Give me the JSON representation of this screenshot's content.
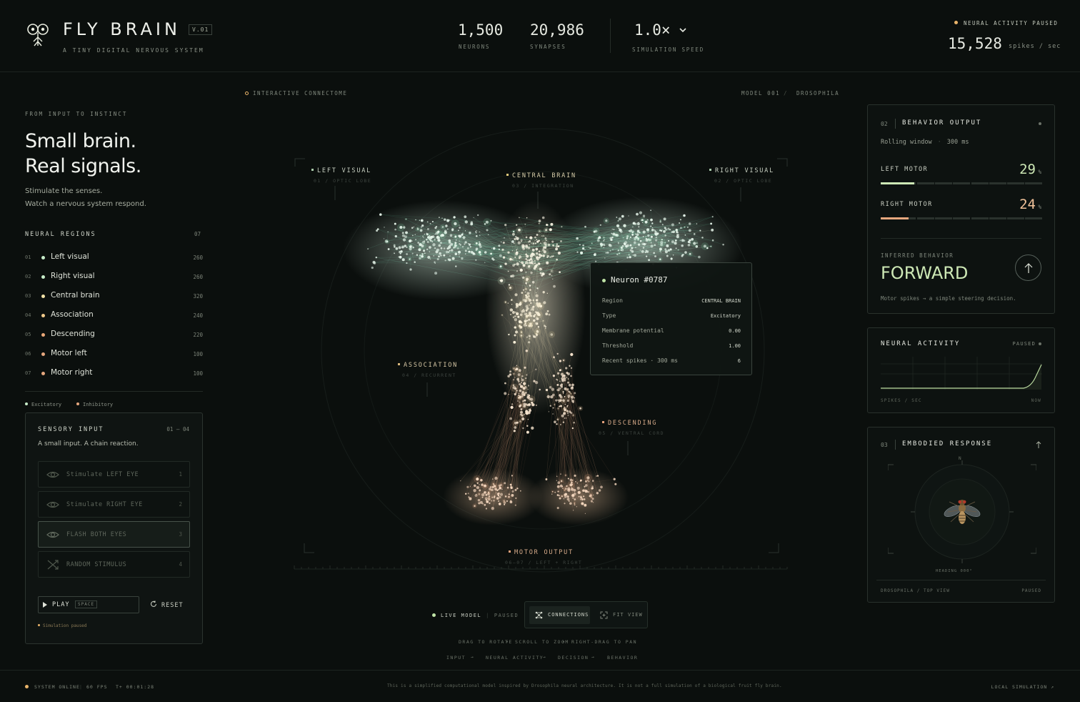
{
  "header": {
    "brand": "FLY BRAIN",
    "version": "V.01",
    "tagline": "A TINY DIGITAL NERVOUS SYSTEM",
    "neurons_value": "1,500",
    "neurons_label": "NEURONS",
    "synapses_value": "20,986",
    "synapses_label": "SYNAPSES",
    "speed_value": "1.0×",
    "speed_label": "SIMULATION SPEED",
    "status": "NEURAL ACTIVITY PAUSED",
    "spikes_value": "15,528",
    "spikes_unit": "spikes / sec"
  },
  "left": {
    "eyebrow": "FROM INPUT TO INSTINCT",
    "headline_line1": "Small brain.",
    "headline_line2": "Real signals.",
    "sub_line1": "Stimulate the senses.",
    "sub_line2": "Watch a nervous system respond.",
    "regions_title": "NEURAL REGIONS",
    "regions_count": "07",
    "regions": [
      {
        "idx": "01",
        "name": "Left visual",
        "count": "260",
        "color": "#c7ecc9"
      },
      {
        "idx": "02",
        "name": "Right visual",
        "count": "260",
        "color": "#c7ecc9"
      },
      {
        "idx": "03",
        "name": "Central brain",
        "count": "320",
        "color": "#f2e2a8"
      },
      {
        "idx": "04",
        "name": "Association",
        "count": "240",
        "color": "#f0c98a"
      },
      {
        "idx": "05",
        "name": "Descending",
        "count": "220",
        "color": "#eaa878"
      },
      {
        "idx": "06",
        "name": "Motor left",
        "count": "100",
        "color": "#e6a77e"
      },
      {
        "idx": "07",
        "name": "Motor right",
        "count": "100",
        "color": "#e6a77e"
      }
    ],
    "legend_excitatory": "Excitatory",
    "legend_inhibitory": "Inhibitory",
    "sensory": {
      "title": "SENSORY INPUT",
      "range": "01 — 04",
      "desc": "A small input. A chain reaction.",
      "buttons": [
        {
          "label": "Stimulate LEFT EYE",
          "key": "1"
        },
        {
          "label": "Stimulate RIGHT EYE",
          "key": "2"
        },
        {
          "label": "FLASH BOTH EYES",
          "key": "3"
        },
        {
          "label": "RANDOM STIMULUS",
          "key": "4"
        }
      ],
      "play_label": "PLAY",
      "play_key": "SPACE",
      "reset_label": "RESET",
      "status": "Simulation paused"
    }
  },
  "center": {
    "connectome_label": "INTERACTIVE CONNECTOME",
    "model_label": "MODEL 001",
    "species_label": "DROSOPHILA",
    "regions": {
      "left_visual": "LEFT VISUAL",
      "left_visual_sub": "01 / OPTIC LOBE",
      "central_brain": "CENTRAL BRAIN",
      "central_brain_sub": "03 / INTEGRATION",
      "right_visual": "RIGHT VISUAL",
      "right_visual_sub": "02 / OPTIC LOBE",
      "association": "ASSOCIATION",
      "association_sub": "04 / RECURRENT",
      "descending": "DESCENDING",
      "descending_sub": "05 / VENTRAL CORD",
      "motor_output": "MOTOR OUTPUT",
      "motor_output_sub": "06—07 / LEFT + RIGHT"
    },
    "tooltip": {
      "title": "Neuron #0787",
      "rows": [
        {
          "k": "Region",
          "v": "CENTRAL BRAIN"
        },
        {
          "k": "Type",
          "v": "Excitatory"
        },
        {
          "k": "Membrane potential",
          "v": "0.00"
        },
        {
          "k": "Threshold",
          "v": "1.00"
        },
        {
          "k": "Recent spikes · 300 ms",
          "v": "6"
        }
      ]
    },
    "live_model": "LIVE MODEL",
    "live_state": "PAUSED",
    "connections": "CONNECTIONS",
    "fit_view": "FIT VIEW",
    "hint_rotate": "DRAG TO ROTATE",
    "hint_zoom": "SCROLL TO ZOOM",
    "hint_pan": "RIGHT-DRAG TO PAN",
    "flow": [
      "INPUT",
      "NEURAL ACTIVITY",
      "DECISION",
      "BEHAVIOR"
    ]
  },
  "right": {
    "behavior": {
      "num": "02",
      "title": "BEHAVIOR OUTPUT",
      "window_label": "Rolling window",
      "window_value": "300 ms",
      "left_label": "LEFT MOTOR",
      "left_value": "29",
      "left_fraction": 0.29,
      "right_label": "RIGHT MOTOR",
      "right_value": "24",
      "right_fraction": 0.24,
      "pct": "%",
      "inferred_label": "INFERRED BEHAVIOR",
      "inferred_value": "FORWARD",
      "inferred_desc": "Motor spikes → a simple steering decision."
    },
    "activity": {
      "title": "NEURAL ACTIVITY",
      "state": "PAUSED",
      "axis_left": "SPIKES / SEC",
      "axis_right": "NOW"
    },
    "embodied": {
      "num": "03",
      "title": "EMBODIED RESPONSE",
      "compass_n": "N",
      "heading": "HEADING 000°",
      "foot_left": "DROSOPHILA / TOP VIEW",
      "foot_right": "PAUSED"
    }
  },
  "footer": {
    "system": "SYSTEM ONLINE",
    "fps": "60 FPS",
    "time": "T+ 00:01:28",
    "disclaimer": "This is a simplified computational model inspired by Drosophila neural architecture. It is not a full simulation of a biological fruit fly brain.",
    "local": "LOCAL SIMULATION ↗"
  },
  "colors": {
    "accent_green": "#c7ecc9",
    "accent_orange": "#e6a77e",
    "accent_yellow": "#e9b46a"
  }
}
